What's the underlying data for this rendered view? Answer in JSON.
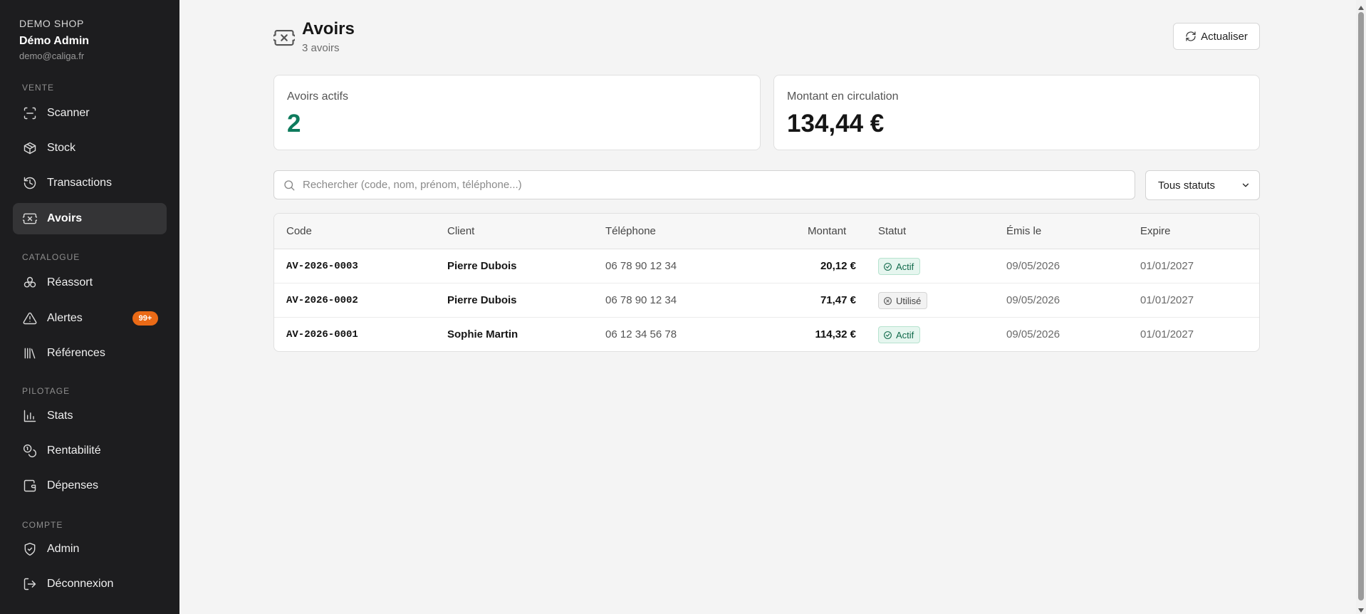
{
  "sidebar": {
    "shop_name": "DEMO SHOP",
    "user_name": "Démo Admin",
    "user_email": "demo@caliga.fr",
    "sections": {
      "vente": "VENTE",
      "catalogue": "CATALOGUE",
      "pilotage": "PILOTAGE",
      "compte": "COMPTE"
    },
    "items": {
      "scanner": "Scanner",
      "stock": "Stock",
      "transactions": "Transactions",
      "avoirs": "Avoirs",
      "reassort": "Réassort",
      "alertes": "Alertes",
      "alertes_badge": "99+",
      "references": "Références",
      "stats": "Stats",
      "rentabilite": "Rentabilité",
      "depenses": "Dépenses",
      "admin": "Admin",
      "deconnexion": "Déconnexion"
    }
  },
  "header": {
    "title": "Avoirs",
    "subtitle": "3 avoirs",
    "refresh_label": "Actualiser"
  },
  "stats": {
    "active_label": "Avoirs actifs",
    "active_value": "2",
    "circulation_label": "Montant en circulation",
    "circulation_value": "134,44 €"
  },
  "filters": {
    "search_placeholder": "Rechercher (code, nom, prénom, téléphone...)",
    "status_selected": "Tous statuts"
  },
  "table": {
    "columns": {
      "code": "Code",
      "client": "Client",
      "telephone": "Téléphone",
      "montant": "Montant",
      "statut": "Statut",
      "emis": "Émis le",
      "expire": "Expire"
    },
    "rows": [
      {
        "code": "AV-2026-0003",
        "client": "Pierre Dubois",
        "telephone": "06 78 90 12 34",
        "montant": "20,12 €",
        "statut": "Actif",
        "emis": "09/05/2026",
        "expire": "01/01/2027"
      },
      {
        "code": "AV-2026-0002",
        "client": "Pierre Dubois",
        "telephone": "06 78 90 12 34",
        "montant": "71,47 €",
        "statut": "Utilisé",
        "emis": "09/05/2026",
        "expire": "01/01/2027"
      },
      {
        "code": "AV-2026-0001",
        "client": "Sophie Martin",
        "telephone": "06 12 34 56 78",
        "montant": "114,32 €",
        "statut": "Actif",
        "emis": "09/05/2026",
        "expire": "01/01/2027"
      }
    ]
  },
  "colors": {
    "sidebar_bg": "#1d1d1f",
    "accent_green": "#0e7b5d",
    "badge_orange": "#ea6a16"
  }
}
